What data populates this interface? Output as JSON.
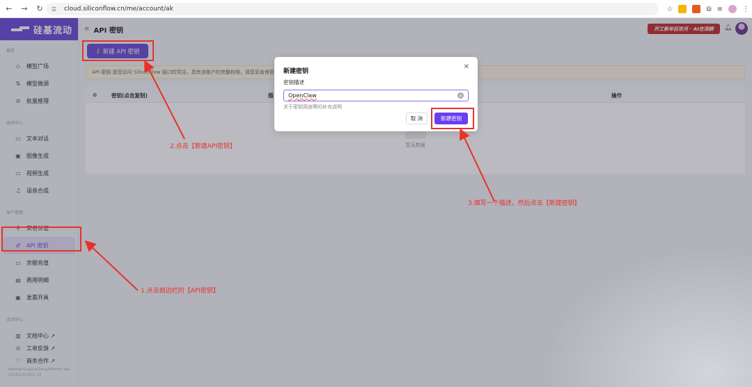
{
  "browser": {
    "url": "cloud.siliconflow.cn/me/account/ak"
  },
  "app": {
    "logo_text": "硅基流动",
    "page_title": "API 密钥",
    "promo_text": "开工新年狂欢月 · AI在深耕",
    "colors": {
      "brand": "#6b4fd6",
      "annotation": "#e8312a"
    }
  },
  "sidebar": {
    "sections": [
      {
        "title": "模型",
        "items": [
          {
            "label": "模型广场",
            "icon": "cube-icon"
          },
          {
            "label": "模型微调",
            "icon": "tune-icon"
          },
          {
            "label": "批量推理",
            "icon": "batch-icon"
          }
        ]
      },
      {
        "title": "体验中心",
        "items": [
          {
            "label": "文本对话",
            "icon": "chat-icon"
          },
          {
            "label": "图像生成",
            "icon": "image-icon"
          },
          {
            "label": "视频生成",
            "icon": "video-icon"
          },
          {
            "label": "语音合成",
            "icon": "voice-icon"
          }
        ]
      },
      {
        "title": "账户管理",
        "items": [
          {
            "label": "实名认证",
            "icon": "user-check-icon"
          },
          {
            "label": "API 密钥",
            "icon": "key-icon",
            "active": true
          },
          {
            "label": "余额充值",
            "icon": "card-icon"
          },
          {
            "label": "费用明细",
            "icon": "bill-icon"
          },
          {
            "label": "发票开具",
            "icon": "invoice-icon"
          }
        ]
      },
      {
        "title": "流动中心",
        "items": [
          {
            "label": "文档中心 ↗",
            "icon": "doc-icon"
          },
          {
            "label": "工单反馈 ↗",
            "icon": "help-icon"
          },
          {
            "label": "商务合作 ↗",
            "icon": "handshake-icon"
          }
        ]
      }
    ],
    "footer": "Beijing-GuiJiLiuDongAPIunFu Wu-20251201501 12"
  },
  "content": {
    "new_button": "新建 API 密钥",
    "notice": "API 密钥 是您访问 SiliconFlow 接口的凭证，具有该账户的完整权限，请您妥善保管",
    "columns": {
      "key": "密钥(点击复制)",
      "desc": "描",
      "actions": "操作"
    },
    "empty_text": "暂无数据"
  },
  "modal": {
    "title": "新建密钥",
    "field_label": "密钥描述",
    "field_value": "OpenClaw",
    "field_help": "关于密钥用途等的补充说明",
    "cancel": "取 消",
    "create": "新建密钥"
  },
  "annotations": {
    "step1": "1.点击侧边栏的【API密钥】",
    "step2": "2.点击【新建API密钥】",
    "step3": "3.填写一个描述，然后点击【新建密钥】"
  }
}
